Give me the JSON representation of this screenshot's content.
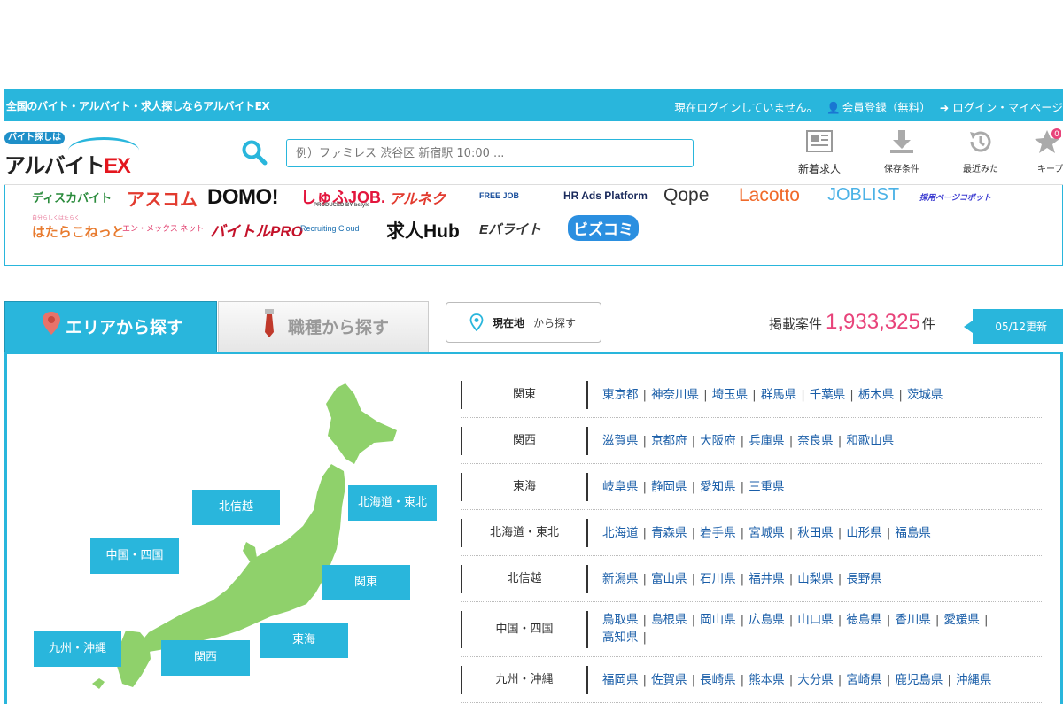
{
  "topbar": {
    "site_title": "全国のバイト・アルバイト・求人探しならアルバイトEX",
    "login_status": "現在ログインしていません。",
    "register_label": "会員登録（無料）",
    "login_label": "ログイン・マイページ"
  },
  "header": {
    "logo_top": "バイト探しは",
    "logo_main": "アルバイト",
    "logo_ex": "EX",
    "search_placeholder": "例）ファミレス 渋谷区 新宿駅 10:00 ...",
    "nav": [
      {
        "label": "新着求人",
        "icon": "newspaper-icon"
      },
      {
        "label": "保存条件",
        "icon": "download-icon"
      },
      {
        "label": "最近みた",
        "icon": "history-icon"
      },
      {
        "label": "キープ",
        "icon": "star-icon",
        "badge": "0"
      }
    ]
  },
  "partners": [
    "ディスカバイト",
    "アスコム",
    "DOMO!",
    "しゅふJOB.",
    "アルネク",
    "FREE JOB",
    "HR Ads Platform",
    "Qope",
    "Lacotto",
    "JOBLIST",
    "採用ページコボット",
    "はたらこねっと",
    "エン・メックス ネット",
    "バイトルPRO",
    "Recruiting Cloud",
    "求人Hub",
    "Eバライト",
    "ビズコミ"
  ],
  "partner_sub": {
    "shufu": "PRODUCED BY bstyle",
    "hatarako": "自分らしくはたらく"
  },
  "tabs": {
    "area": "エリアから探す",
    "job": "職種から探す"
  },
  "geo": {
    "bold": "現在地",
    "rest": "から探す"
  },
  "count": {
    "prefix": "掲載案件",
    "number": "1,933,325",
    "suffix": "件"
  },
  "update_label": "05/12更新",
  "map_regions": [
    "北信越",
    "北海道・東北",
    "中国・四国",
    "関東",
    "九州・沖縄",
    "関西",
    "東海"
  ],
  "regions": [
    {
      "name": "関東",
      "prefs": [
        "東京都",
        "神奈川県",
        "埼玉県",
        "群馬県",
        "千葉県",
        "栃木県",
        "茨城県"
      ]
    },
    {
      "name": "関西",
      "prefs": [
        "滋賀県",
        "京都府",
        "大阪府",
        "兵庫県",
        "奈良県",
        "和歌山県"
      ]
    },
    {
      "name": "東海",
      "prefs": [
        "岐阜県",
        "静岡県",
        "愛知県",
        "三重県"
      ]
    },
    {
      "name": "北海道・東北",
      "prefs": [
        "北海道",
        "青森県",
        "岩手県",
        "宮城県",
        "秋田県",
        "山形県",
        "福島県"
      ]
    },
    {
      "name": "北信越",
      "prefs": [
        "新潟県",
        "富山県",
        "石川県",
        "福井県",
        "山梨県",
        "長野県"
      ]
    },
    {
      "name": "中国・四国",
      "prefs": [
        "鳥取県",
        "島根県",
        "岡山県",
        "広島県",
        "山口県",
        "徳島県",
        "香川県",
        "愛媛県",
        "高知県"
      ]
    },
    {
      "name": "九州・沖縄",
      "prefs": [
        "福岡県",
        "佐賀県",
        "長崎県",
        "熊本県",
        "大分県",
        "宮崎県",
        "鹿児島県",
        "沖縄県"
      ]
    }
  ],
  "colors": {
    "accent": "#29b6dc",
    "link": "#1a5ea8",
    "count": "#e8437a",
    "map": "#8fd16b"
  }
}
